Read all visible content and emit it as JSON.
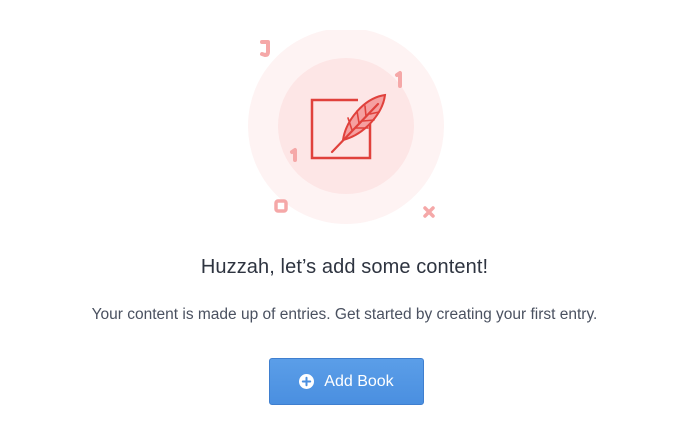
{
  "empty_state": {
    "headline": "Huzzah, let’s add some content!",
    "description": "Your content is made up of entries. Get started by creating your first entry.",
    "illustration_icon": "feather-quill-icon"
  },
  "actions": {
    "add_button_label": "Add Book",
    "add_button_icon": "plus-circle-icon"
  },
  "colors": {
    "accent_blue": "#4a8fe0",
    "illustration_red": "#e0413c",
    "illustration_bg": "#fdeeee"
  }
}
